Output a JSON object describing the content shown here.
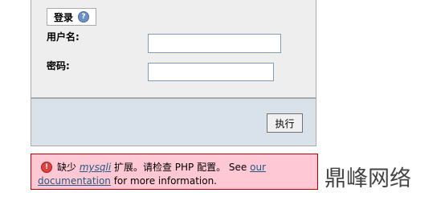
{
  "login": {
    "legend_title": "登录",
    "help_icon_glyph": "?",
    "username_label": "用户名:",
    "username_value": "",
    "password_label": "密码:",
    "password_value": "",
    "submit_label": "执行"
  },
  "error": {
    "icon_glyph": "!",
    "prefix": "缺少 ",
    "extension_link": "mysqli",
    "middle": " 扩展。请检查 PHP 配置。 See ",
    "our_link": "our",
    "documentation_link": "documentation",
    "suffix": " for more information."
  },
  "watermark": {
    "text": "鼎峰网络"
  },
  "colors": {
    "fieldset_bg": "#eeeeee",
    "footer_bg": "#d9e2ea",
    "error_bg": "#ffc8d4",
    "error_border": "#c00000",
    "link": "#235a81"
  }
}
